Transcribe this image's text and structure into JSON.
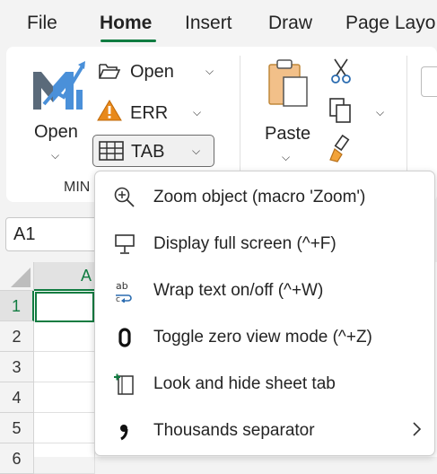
{
  "ribbon_tabs": [
    "File",
    "Home",
    "Insert",
    "Draw",
    "Page Layo"
  ],
  "ribbon": {
    "open_large_label": "Open",
    "open_small_label": "Open",
    "err_label": "ERR",
    "tab_label": "TAB",
    "group_label": "MIN",
    "paste_label": "Paste"
  },
  "name_box": {
    "value": "A1"
  },
  "grid": {
    "column_header": "A",
    "row_headers": [
      "1",
      "2",
      "3",
      "4",
      "5",
      "6"
    ]
  },
  "menu": {
    "items": [
      {
        "label": "Zoom object (macro 'Zoom')",
        "icon": "zoom-in-icon"
      },
      {
        "label": "Display full screen (^+F)",
        "icon": "full-screen-icon"
      },
      {
        "label": "Wrap text on/off (^+W)",
        "icon": "wrap-text-icon"
      },
      {
        "label": "Toggle zero view mode (^+Z)",
        "icon": "zero-icon"
      },
      {
        "label": "Look and hide sheet tab",
        "icon": "sheet-tab-icon"
      },
      {
        "label": "Thousands separator",
        "icon": "comma-icon",
        "has_submenu": true
      }
    ]
  },
  "colors": {
    "accent_green": "#107c41",
    "logo_blue": "#4a90d9",
    "logo_grey": "#5a6a7a",
    "warning_orange": "#e8891b"
  }
}
